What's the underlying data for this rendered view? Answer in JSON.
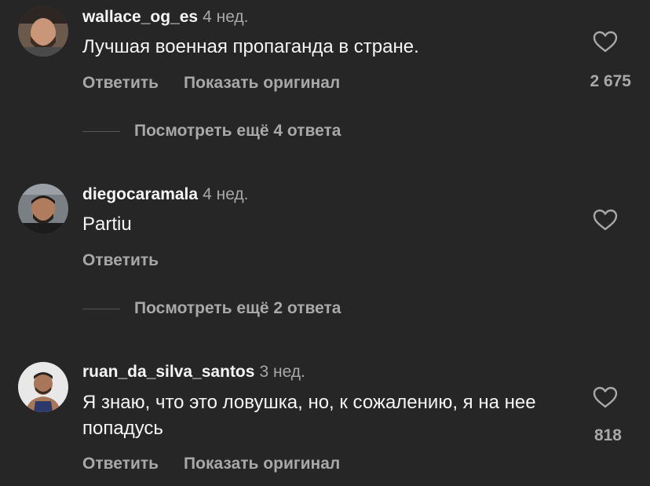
{
  "comments": [
    {
      "username": "wallace_og_es",
      "time": "4 нед.",
      "text": "Лучшая военная пропаганда в стране.",
      "reply_label": "Ответить",
      "translate_label": "Показать оригинал",
      "likes": "2 675",
      "avatar_icon": "user-avatar"
    },
    {
      "username": "diegocaramala",
      "time": "4 нед.",
      "text": "Partiu",
      "reply_label": "Ответить",
      "avatar_icon": "user-avatar"
    },
    {
      "username": "ruan_da_silva_santos",
      "time": "3 нед.",
      "text": "Я знаю, что это ловушка, но, к сожалению, я на нее попадусь",
      "reply_label": "Ответить",
      "translate_label": "Показать оригинал",
      "likes": "818",
      "avatar_icon": "user-avatar"
    }
  ],
  "view_replies": [
    {
      "label": "Посмотреть ещё 4 ответа"
    },
    {
      "label": "Посмотреть ещё 2 ответа"
    }
  ],
  "colors": {
    "background": "#262626",
    "primary_text": "#f5f5f5",
    "secondary_text": "#a8a8a8",
    "heart_outline": "#a8a8a8"
  },
  "icons": {
    "like": "heart-outline-icon",
    "replies_divider": "horizontal-line"
  }
}
